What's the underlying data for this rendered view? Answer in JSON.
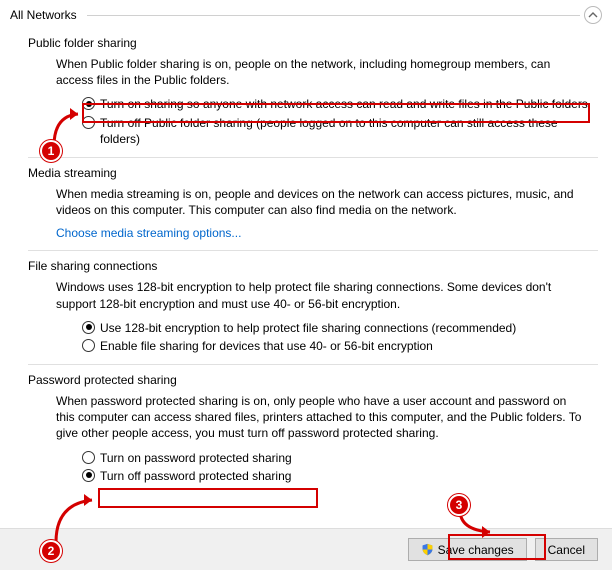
{
  "header": {
    "title": "All Networks"
  },
  "sections": {
    "public_folder": {
      "title": "Public folder sharing",
      "desc": "When Public folder sharing is on, people on the network, including homegroup members, can access files in the Public folders.",
      "opt_on": "Turn on sharing so anyone with network access can read and write files in the Public folders",
      "opt_off": "Turn off Public folder sharing (people logged on to this computer can still access these folders)"
    },
    "media": {
      "title": "Media streaming",
      "desc": "When media streaming is on, people and devices on the network can access pictures, music, and videos on this computer. This computer can also find media on the network.",
      "link": "Choose media streaming options..."
    },
    "file_sharing": {
      "title": "File sharing connections",
      "desc": "Windows uses 128-bit encryption to help protect file sharing connections. Some devices don't support 128-bit encryption and must use 40- or 56-bit encryption.",
      "opt_128": "Use 128-bit encryption to help protect file sharing connections (recommended)",
      "opt_40": "Enable file sharing for devices that use 40- or 56-bit encryption"
    },
    "password": {
      "title": "Password protected sharing",
      "desc": "When password protected sharing is on, only people who have a user account and password on this computer can access shared files, printers attached to this computer, and the Public folders. To give other people access, you must turn off password protected sharing.",
      "opt_on": "Turn on password protected sharing",
      "opt_off": "Turn off password protected sharing"
    }
  },
  "footer": {
    "save": "Save changes",
    "cancel": "Cancel"
  },
  "annotations": {
    "badge1": "1",
    "badge2": "2",
    "badge3": "3"
  },
  "colors": {
    "annotation": "#d40000",
    "link": "#0066cc"
  }
}
